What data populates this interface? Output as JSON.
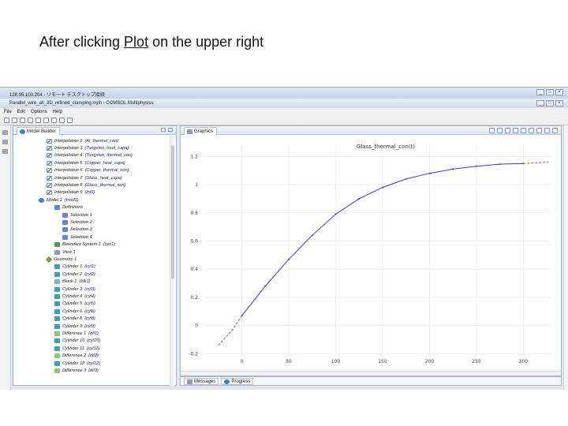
{
  "caption": {
    "before": "After clicking ",
    "link": "Plot",
    "after": " on the upper right"
  },
  "remote_title": "128.95.100.204 - リモート デスクトップ接続",
  "app_title": "Parallel_wire_all_3D_refined_clamping.mph - COMSOL Multiphysics",
  "menu": [
    "File",
    "Edit",
    "Options",
    "Help"
  ],
  "model_builder": {
    "tab_label": "Model Builder",
    "nodes": [
      {
        "label": "Interpolation 2",
        "arg": "(Al_thermal_con)",
        "icon": "interp"
      },
      {
        "label": "Interpolation 3",
        "arg": "(Tungsten_heat_capa)",
        "icon": "interp"
      },
      {
        "label": "Interpolation 4",
        "arg": "(Tungsten_thermal_con)",
        "icon": "interp"
      },
      {
        "label": "Interpolation 5",
        "arg": "(Copper_heat_capa)",
        "icon": "interp"
      },
      {
        "label": "Interpolation 6",
        "arg": "(Copper_thermal_con)",
        "icon": "interp"
      },
      {
        "label": "Interpolation 7",
        "arg": "(Glass_heat_capa)",
        "icon": "interp"
      },
      {
        "label": "Interpolation 8",
        "arg": "(Glass_thermal_con)",
        "icon": "interp"
      },
      {
        "label": "Interpolation 9",
        "arg": "(int9)",
        "icon": "interp"
      },
      {
        "label": "Model 1",
        "arg": "(mod1)",
        "icon": "model"
      },
      {
        "label": "Definitions",
        "arg": "",
        "icon": "def"
      },
      {
        "label": "Selection 1",
        "arg": "",
        "icon": "sel"
      },
      {
        "label": "Selection 2",
        "arg": "",
        "icon": "sel"
      },
      {
        "label": "Selection 3",
        "arg": "",
        "icon": "sel"
      },
      {
        "label": "Selection 4",
        "arg": "",
        "icon": "sel"
      },
      {
        "label": "Boundary System 1",
        "arg": "(sys1)",
        "icon": "bsys"
      },
      {
        "label": "View 1",
        "arg": "",
        "icon": "view"
      },
      {
        "label": "Geometry 1",
        "arg": "",
        "icon": "geom"
      },
      {
        "label": "Cylinder 1",
        "arg": "(cyl1)",
        "icon": "cyl"
      },
      {
        "label": "Cylinder 2",
        "arg": "(cyl2)",
        "icon": "cyl"
      },
      {
        "label": "Block 1",
        "arg": "(blk1)",
        "icon": "blk"
      },
      {
        "label": "Cylinder 3",
        "arg": "(cyl3)",
        "icon": "cyl"
      },
      {
        "label": "Cylinder 4",
        "arg": "(cyl4)",
        "icon": "cyl"
      },
      {
        "label": "Cylinder 5",
        "arg": "(cyl5)",
        "icon": "cyl"
      },
      {
        "label": "Cylinder 6",
        "arg": "(cyl6)",
        "icon": "cyl"
      },
      {
        "label": "Cylinder 8",
        "arg": "(cyl8)",
        "icon": "cyl"
      },
      {
        "label": "Cylinder 9",
        "arg": "(cyl9)",
        "icon": "cyl"
      },
      {
        "label": "Difference 1",
        "arg": "(dif1)",
        "icon": "diff"
      },
      {
        "label": "Cylinder 10",
        "arg": "(cyl10)",
        "icon": "cyl"
      },
      {
        "label": "Cylinder 11",
        "arg": "(cyl11)",
        "icon": "cyl"
      },
      {
        "label": "Difference 2",
        "arg": "(dif2)",
        "icon": "diff"
      },
      {
        "label": "Cylinder 12",
        "arg": "(cyl12)",
        "icon": "cyl"
      },
      {
        "label": "Difference 3",
        "arg": "(dif3)",
        "icon": "diff"
      }
    ]
  },
  "graphics": {
    "tab_label": "Graphics"
  },
  "bottom_tabs": {
    "messages": "Messages",
    "progress": "Progress"
  },
  "colors": {
    "curve_inside": "#3b3bb8",
    "curve_extrapolated": "#d04a2a"
  },
  "chart_data": {
    "type": "line",
    "title": "Glass_thermal_con(t)",
    "xlim": [
      -40,
      330
    ],
    "ylim": [
      -0.22,
      1.28
    ],
    "x_ticks": [
      0,
      50,
      100,
      150,
      200,
      250,
      300
    ],
    "y_ticks": [
      -0.2,
      0,
      0.2,
      0.4,
      0.6,
      0.8,
      1,
      1.2
    ],
    "x_tick_labels": [
      "0",
      "50",
      "100",
      "150",
      "200",
      "250",
      "300"
    ],
    "y_tick_labels": [
      "-0.2",
      "0",
      "0.2",
      "0.4",
      "0.6",
      "0.8",
      "1",
      "1.2"
    ],
    "series": [
      {
        "segment": "extrapolated",
        "x": [
          -25,
          -10,
          0
        ],
        "y": [
          -0.14,
          -0.03,
          0.07
        ]
      },
      {
        "segment": "interpolated",
        "x": [
          0,
          25,
          50,
          75,
          100,
          125,
          150,
          175,
          200,
          225,
          250,
          275,
          300
        ],
        "y": [
          0.07,
          0.28,
          0.47,
          0.64,
          0.79,
          0.9,
          0.98,
          1.04,
          1.08,
          1.11,
          1.13,
          1.145,
          1.15
        ]
      },
      {
        "segment": "extrapolated",
        "x": [
          300,
          315,
          327
        ],
        "y": [
          1.15,
          1.155,
          1.16
        ]
      }
    ]
  }
}
